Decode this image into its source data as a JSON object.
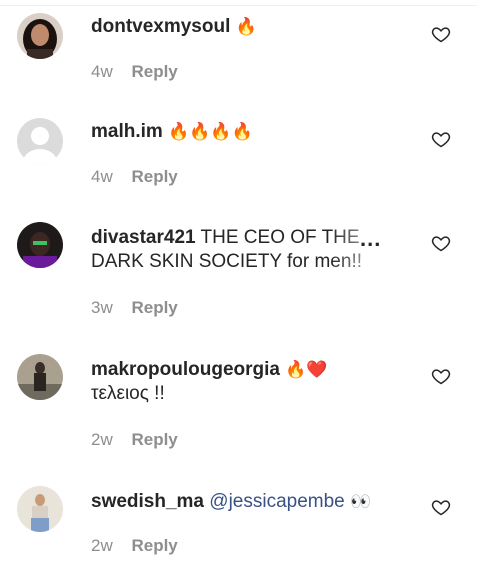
{
  "comments": [
    {
      "username": "dontvexmysoul",
      "text": "",
      "emoji": "🔥",
      "age": "4w",
      "reply_label": "Reply"
    },
    {
      "username": "malh.im",
      "text": "",
      "emoji": "🔥🔥🔥🔥",
      "age": "4w",
      "reply_label": "Reply"
    },
    {
      "username": "divastar421",
      "text": "THE CEO OF THE DARK SKIN SOCIETY for men!!",
      "emoji": "",
      "more": "...",
      "age": "3w",
      "reply_label": "Reply"
    },
    {
      "username": "makropoulougeorgia",
      "text": "",
      "emoji": "🔥❤️",
      "line2": "τελειος !!",
      "age": "2w",
      "reply_label": "Reply"
    },
    {
      "username": "swedish_ma",
      "mention": "@jessicapembe",
      "emoji": "👀",
      "age": "2w",
      "reply_label": "Reply"
    }
  ],
  "icons": {
    "like": "heart-outline-icon",
    "default_avatar": "default-avatar-icon"
  },
  "colors": {
    "text": "#262626",
    "muted": "#8e8e8e",
    "mention": "#385185",
    "fire": "#f26522",
    "heart_red": "#ed1c3a"
  }
}
